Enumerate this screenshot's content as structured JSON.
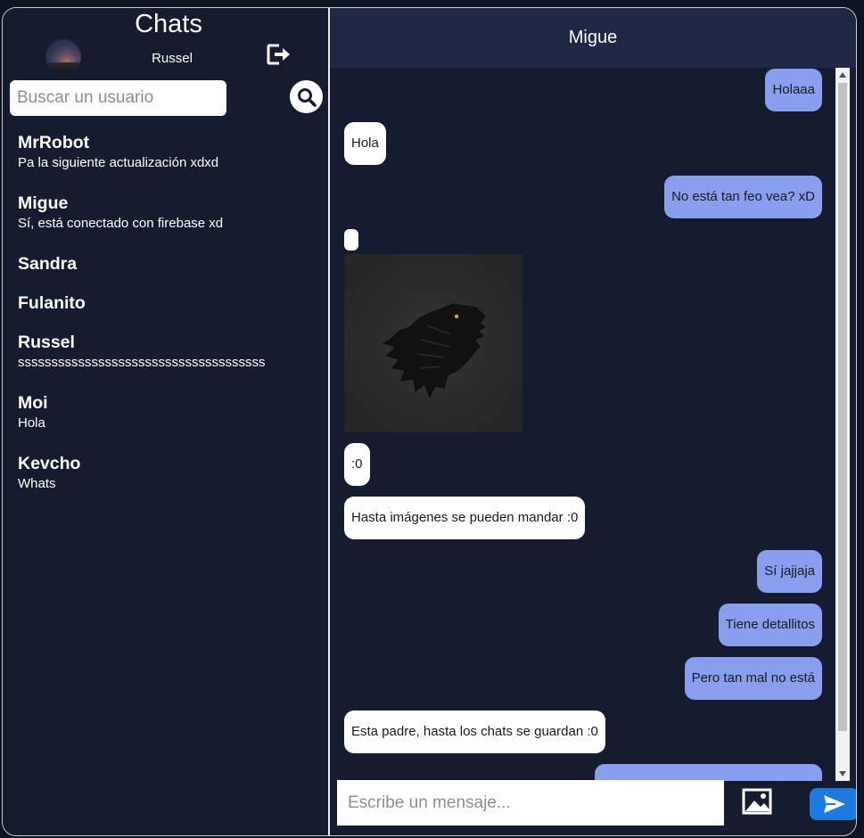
{
  "sidebar": {
    "title": "Chats",
    "current_user": "Russel",
    "search_placeholder": "Buscar un usuario",
    "chats": [
      {
        "name": "MrRobot",
        "last": "Pa la siguiente actualización xdxd"
      },
      {
        "name": "Migue",
        "last": "Sí, está conectado con firebase xd"
      },
      {
        "name": "Sandra",
        "last": ""
      },
      {
        "name": "Fulanito",
        "last": ""
      },
      {
        "name": "Russel",
        "last": "sssssssssssssssssssssssssssssssssssss"
      },
      {
        "name": "Moi",
        "last": "Hola"
      },
      {
        "name": "Kevcho",
        "last": "Whats"
      }
    ]
  },
  "conversation": {
    "title": "Migue",
    "messages": [
      {
        "from": "me",
        "text": "Holaaa"
      },
      {
        "from": "them",
        "text": "Hola"
      },
      {
        "from": "me",
        "text": "No está tan feo vea? xD"
      },
      {
        "from": "them",
        "text": ""
      },
      {
        "from": "them",
        "text": ":0"
      },
      {
        "from": "them",
        "text": "Hasta imágenes se pueden mandar :0"
      },
      {
        "from": "me",
        "text": "Sí jajjaja"
      },
      {
        "from": "me",
        "text": "Tiene detallitos"
      },
      {
        "from": "me",
        "text": "Pero tan mal no está"
      },
      {
        "from": "them",
        "text": "Esta padre, hasta los chats se guardan :0"
      }
    ],
    "composer_placeholder": "Escribe un mensaje..."
  },
  "icons": {
    "logout": "logout-icon",
    "search": "search-icon",
    "image": "image-icon",
    "send": "send-icon"
  },
  "colors": {
    "background": "#151c30",
    "header": "#1f2945",
    "my_bubble": "#8a9ef0",
    "their_bubble": "#ffffff",
    "send_button": "#1f7ae0"
  }
}
